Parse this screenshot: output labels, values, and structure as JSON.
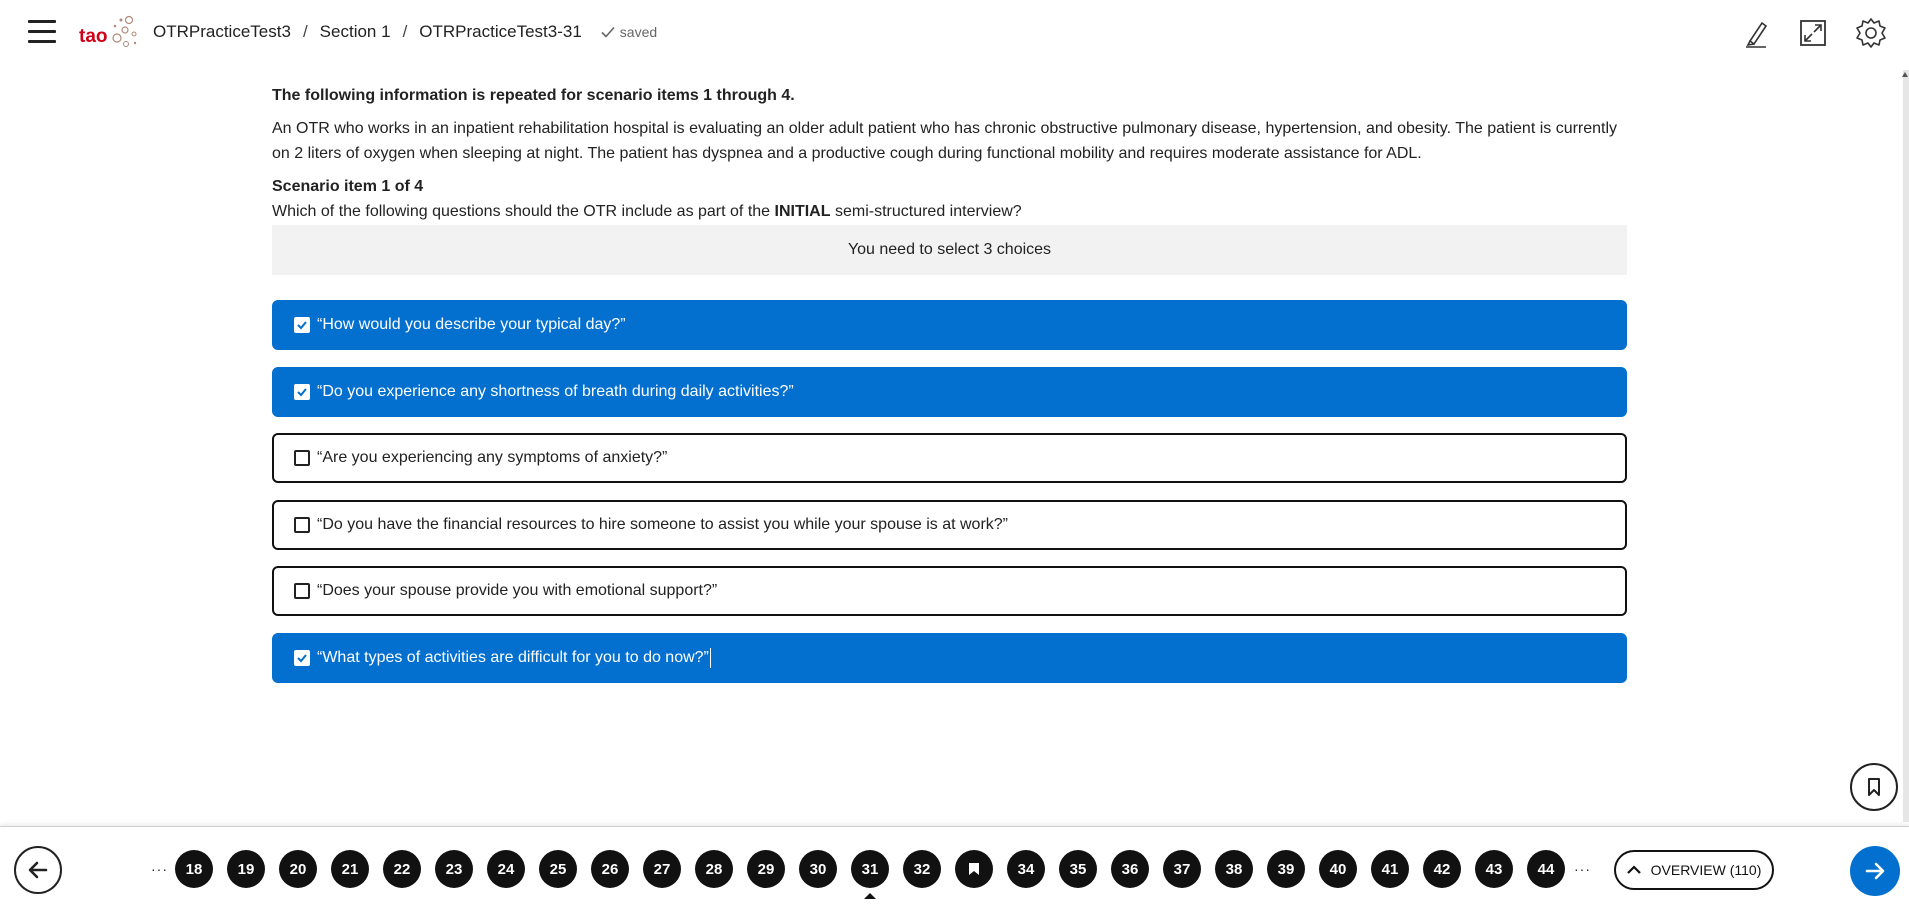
{
  "header": {
    "logo_text": "tao",
    "breadcrumb": [
      "OTRPracticeTest3",
      "Section 1",
      "OTRPracticeTest3-31"
    ],
    "separator": "/",
    "status": "saved"
  },
  "item": {
    "intro_heading": "The following information is repeated for scenario items 1 through 4.",
    "intro_text": "An OTR who works in an inpatient rehabilitation hospital is evaluating an older adult patient who has chronic obstructive pulmonary disease, hypertension, and obesity. The patient is currently on 2 liters of oxygen when sleeping at night. The patient has dyspnea and a productive cough during functional mobility and requires moderate assistance for ADL.",
    "title": "Scenario item 1 of 4",
    "prompt_before": "Which of the following questions should the OTR include as part of the",
    "prompt_emphasis": "INITIAL",
    "prompt_after": "semi-structured interview?",
    "hint": "You need to select 3 choices",
    "choices": [
      {
        "label": "“How would you describe your typical day?”",
        "selected": true
      },
      {
        "label": "“Do you experience any shortness of breath during daily activities?”",
        "selected": true
      },
      {
        "label": "“Are you experiencing any symptoms of anxiety?”",
        "selected": false
      },
      {
        "label": "“Do you have the financial resources to hire someone to assist you while your spouse is at work?”",
        "selected": false
      },
      {
        "label": "“Does your spouse provide you with emotional support?”",
        "selected": false
      },
      {
        "label": "“What types of activities are difficult for you to do now?”",
        "selected": true
      }
    ]
  },
  "footer": {
    "ellipsis": "···",
    "pages": [
      {
        "label": "18"
      },
      {
        "label": "19"
      },
      {
        "label": "20"
      },
      {
        "label": "21"
      },
      {
        "label": "22"
      },
      {
        "label": "23"
      },
      {
        "label": "24"
      },
      {
        "label": "25"
      },
      {
        "label": "26"
      },
      {
        "label": "27"
      },
      {
        "label": "28"
      },
      {
        "label": "29"
      },
      {
        "label": "30"
      },
      {
        "label": "31",
        "current": true
      },
      {
        "label": "32"
      },
      {
        "label": "",
        "flagged": true
      },
      {
        "label": "34"
      },
      {
        "label": "35"
      },
      {
        "label": "36"
      },
      {
        "label": "37"
      },
      {
        "label": "38"
      },
      {
        "label": "39"
      },
      {
        "label": "40"
      },
      {
        "label": "41"
      },
      {
        "label": "42"
      },
      {
        "label": "43"
      },
      {
        "label": "44"
      }
    ],
    "overview_label": "OVERVIEW (110)"
  },
  "colors": {
    "accent": "#0370cf",
    "logo_red": "#d0021b",
    "page_circle": "#111111"
  },
  "icons": {
    "menu": "hamburger-icon",
    "highlighter": "highlighter-icon",
    "fullscreen": "expand-icon",
    "settings": "gear-icon",
    "bookmark": "bookmark-icon",
    "prev": "arrow-left-icon",
    "next": "arrow-right-icon",
    "overview": "chevron-up-icon"
  }
}
